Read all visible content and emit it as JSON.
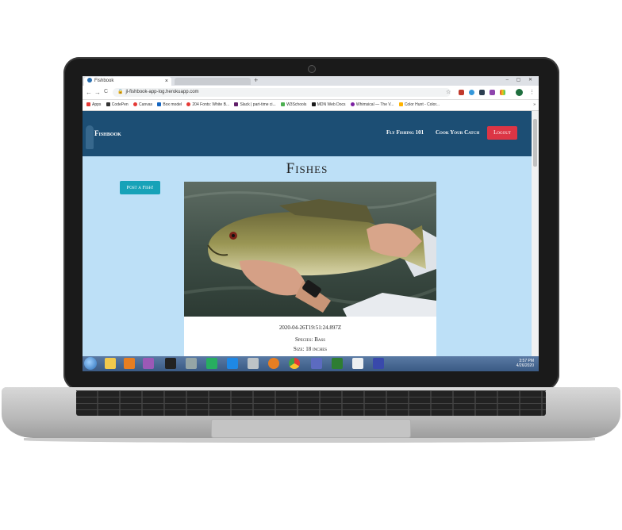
{
  "browser": {
    "tab_title": "Fishbook",
    "tab_close": "×",
    "new_tab": "+",
    "url": "jl-fishbook-app-log.herokuapp.com",
    "nav_back": "←",
    "nav_forward": "→",
    "nav_reload": "C",
    "bookmarks": [
      "Apps",
      "CodePen",
      "Canvas",
      "Box model",
      "204 Fonts: White B...",
      "Slack | part-time ci...",
      "W3Schools",
      "MDN Web Docs",
      "Whimsical — The V...",
      "Color Hunt - Color..."
    ],
    "bookmark_overflow": "»"
  },
  "app": {
    "brand": "Fishbook",
    "nav": {
      "fly_fishing": "Fly Fishing 101",
      "cook": "Cook Your Catch",
      "logout": "Logout"
    },
    "page_title": "Fishes",
    "post_button": "Post a Fish!",
    "post": {
      "timestamp": "2020-04-26T19:51:24.897Z",
      "species": "Species: Bass",
      "size": "Size: 18 inches"
    }
  },
  "taskbar": {
    "time": "3:57 PM",
    "date": "4/26/2020"
  },
  "colors": {
    "navbar": "#1c4e74",
    "page_bg": "#bde0f7",
    "logout_btn": "#dc3545",
    "post_btn": "#17a2b8"
  }
}
